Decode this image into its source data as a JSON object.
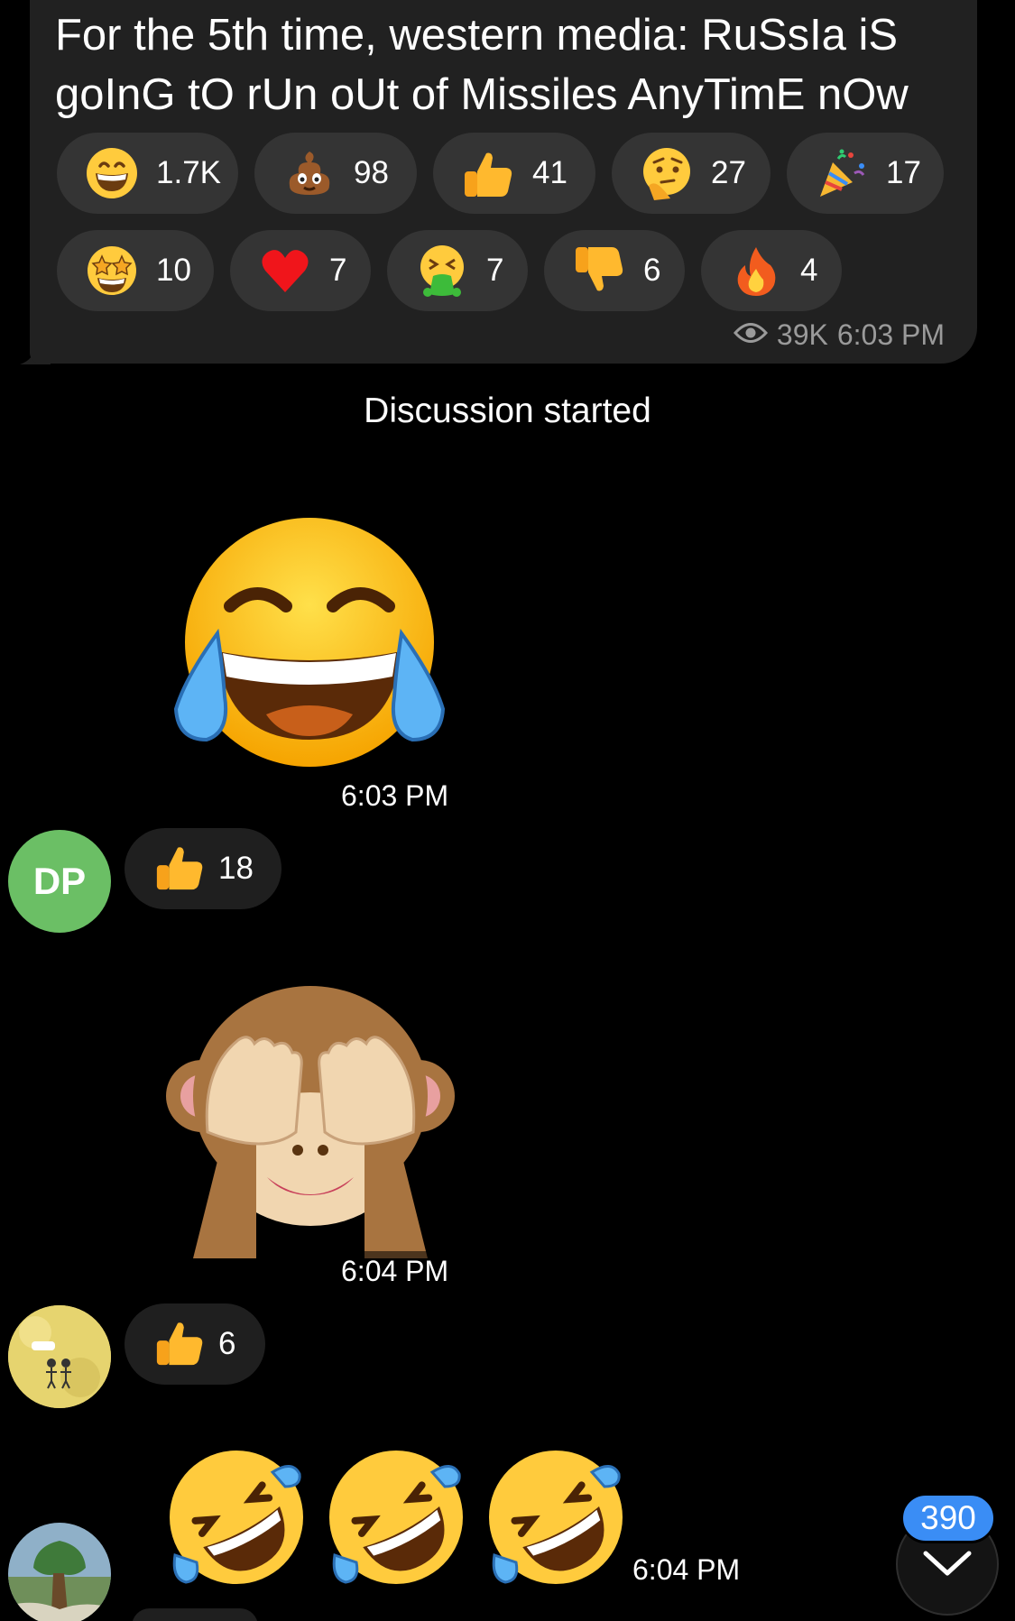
{
  "post": {
    "text": "For the 5th time, western media: RuSsIa iS goInG tO rUn oUt of Missiles AnyTimE nOw",
    "reactions": [
      {
        "icon": "grinning-face-icon",
        "count": "1.7K"
      },
      {
        "icon": "pile-of-poo-icon",
        "count": "98"
      },
      {
        "icon": "thumbs-up-icon",
        "count": "41"
      },
      {
        "icon": "thinking-face-icon",
        "count": "27"
      },
      {
        "icon": "party-popper-icon",
        "count": "17"
      },
      {
        "icon": "star-struck-icon",
        "count": "10"
      },
      {
        "icon": "red-heart-icon",
        "count": "7"
      },
      {
        "icon": "vomiting-face-icon",
        "count": "7"
      },
      {
        "icon": "thumbs-down-icon",
        "count": "6"
      },
      {
        "icon": "fire-icon",
        "count": "4"
      }
    ],
    "views": "39K",
    "time": "6:03 PM"
  },
  "service_message": "Discussion started",
  "messages": [
    {
      "sticker": "tears-of-joy-sticker",
      "time": "6:03 PM",
      "avatar_initials": "DP",
      "reaction_icon": "thumbs-up-icon",
      "reaction_count": "18"
    },
    {
      "sticker": "see-no-evil-monkey-sticker",
      "time": "6:04 PM",
      "avatar": "comic-avatar",
      "reaction_icon": "thumbs-up-icon",
      "reaction_count": "6"
    },
    {
      "stickers": [
        "rolling-on-floor-laughing-sticker",
        "rolling-on-floor-laughing-sticker",
        "rolling-on-floor-laughing-sticker"
      ],
      "time": "6:04 PM",
      "avatar": "landscape-avatar"
    }
  ],
  "scroll_button": {
    "unread_count": "390",
    "icon": "chevron-down-icon"
  },
  "colors": {
    "background": "#000000",
    "bubble": "#212121",
    "reaction_chip": "#343434",
    "badge": "#3a8df5",
    "avatar_dp": "#6bbf65"
  }
}
